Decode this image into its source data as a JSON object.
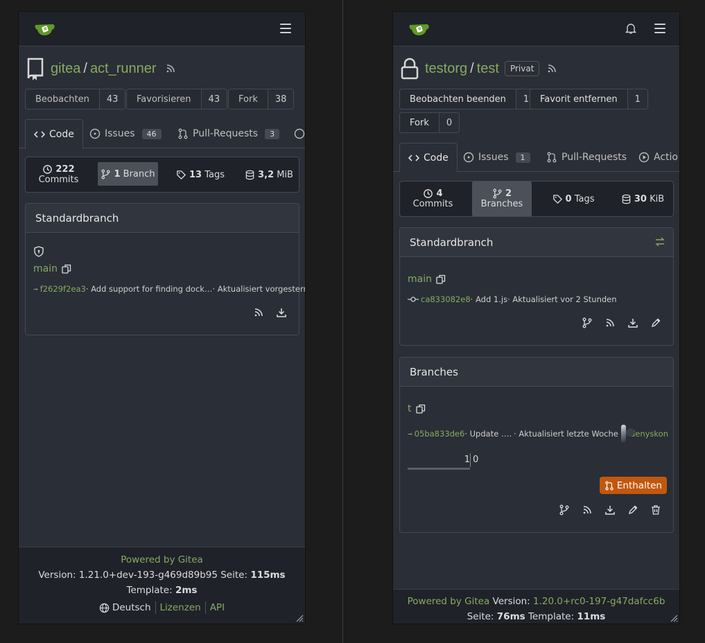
{
  "left": {
    "repo": {
      "owner": "gitea",
      "name": "act_runner"
    },
    "buttons": [
      {
        "label": "Beobachten",
        "count": "43"
      },
      {
        "label": "Favorisieren",
        "count": "43"
      },
      {
        "label": "Fork",
        "count": "38"
      }
    ],
    "tabs": {
      "code": "Code",
      "issues": "Issues",
      "issues_count": "46",
      "pulls": "Pull-Requests",
      "pulls_count": "3"
    },
    "stats": {
      "commits_num": "222",
      "commits_label": "Commits",
      "branch_num": "1",
      "branch_label": "Branch",
      "tags_num": "13",
      "tags_label": "Tags",
      "size_num": "3,2",
      "size_unit": "MiB"
    },
    "default_branch": {
      "header": "Standardbranch",
      "name": "main",
      "sha": "f2629f2ea3",
      "message": " · Add support for finding dock…",
      "updated": " · Aktualisiert vorgestern"
    },
    "footer": {
      "powered": "Powered by Gitea",
      "version_label": "Version: 1.21.0+dev-193-g469d89b95 Seite: ",
      "page_time": "115ms",
      "template_label": "Template: ",
      "template_time": "2ms",
      "language": "Deutsch",
      "licenses": "Lizenzen",
      "api": "API"
    }
  },
  "right": {
    "repo": {
      "owner": "testorg",
      "name": "test",
      "private": "Privat"
    },
    "buttons": [
      {
        "label": "Beobachten beenden",
        "count": "1"
      },
      {
        "label": "Favorit entfernen",
        "count": "1"
      },
      {
        "label": "Fork",
        "count": "0"
      }
    ],
    "tabs": {
      "code": "Code",
      "issues": "Issues",
      "issues_count": "1",
      "pulls": "Pull-Requests",
      "actions": "Actio"
    },
    "stats": {
      "commits_num": "4",
      "commits_label": "Commits",
      "branch_num": "2",
      "branch_label": "Branches",
      "tags_num": "0",
      "tags_label": "Tags",
      "size_num": "30",
      "size_unit": "KiB"
    },
    "default_branch": {
      "header": "Standardbranch",
      "name": "main",
      "sha": "ca833082e8",
      "message": " · Add 1.js",
      "updated": " · Aktualisiert vor 2 Stunden"
    },
    "branches": {
      "header": "Branches",
      "name": "t",
      "sha": "05ba833de6",
      "message": " · Update ….",
      "updated": " · Aktualisiert letzte Woche",
      "author": "denyskon",
      "behind": "1",
      "ahead": "0",
      "pr_button": "Enthalten"
    },
    "footer": {
      "powered": "Powered by Gitea",
      "version_label": " Version: ",
      "version": "1.20.0+rc0-197-g47dafcc6b",
      "page_label": "Seite: ",
      "page_time": "76ms",
      "template_label": " Template: ",
      "template_time": "11ms"
    }
  },
  "colors": {
    "accent": "#87ab63",
    "pr_button": "#c2570e"
  }
}
